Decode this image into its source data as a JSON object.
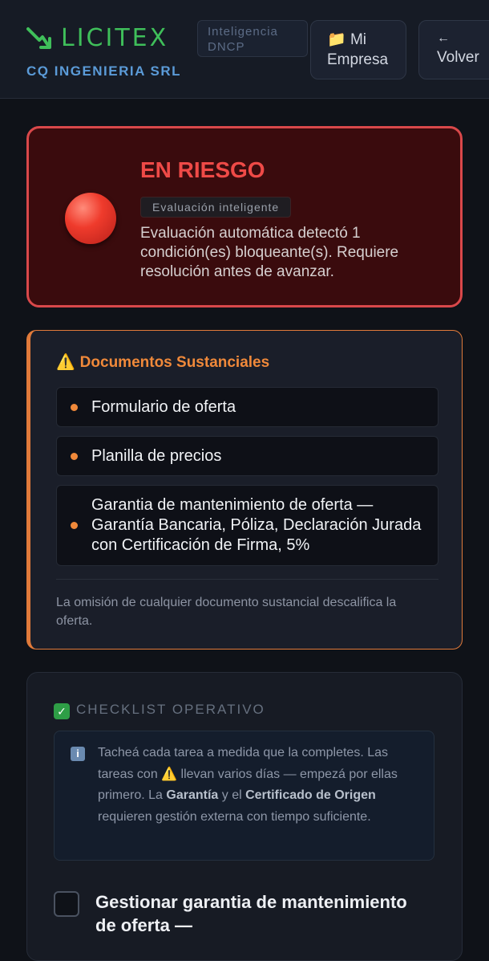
{
  "header": {
    "logo": "LICITEX",
    "company": "CQ INGENIERIA SRL",
    "badge_line1": "Inteligencia",
    "badge_line2": "DNCP",
    "empresa_icon": "📁",
    "empresa_line1": "Mi",
    "empresa_line2": "Empresa",
    "volver_arrow": "←",
    "volver_label": "Volver"
  },
  "risk": {
    "title": "EN RIESGO",
    "badge": "Evaluación inteligente",
    "text": "Evaluación automática detectó 1 condición(es) bloqueante(s). Requiere resolución antes de avanzar."
  },
  "docs": {
    "icon": "⚠️",
    "title": "Documentos Sustanciales",
    "items": [
      "Formulario de oferta",
      "Planilla de precios",
      "Garantia de mantenimiento de oferta — Garantía Bancaria, Póliza, Declaración Jurada con Certificación de Firma, 5%"
    ],
    "note": "La omisión de cualquier documento sustancial descalifica la oferta."
  },
  "checklist": {
    "check_icon": "✓",
    "title": "CHECKLIST OPERATIVO",
    "info_icon": "i",
    "info_part1": "Tacheá cada tarea a medida que la completes. Las tareas con ",
    "info_warn": "⚠️",
    "info_part2": " llevan varios días — empezá por ellas primero. La ",
    "info_bold1": "Garantía",
    "info_part3": " y el ",
    "info_bold2": "Certificado de Origen",
    "info_part4": " requieren gestión externa con tiempo suficiente.",
    "task": "Gestionar garantia de mantenimiento de oferta —"
  },
  "colors": {
    "brand_green": "#3fbf5a",
    "risk_red": "#ef4a47",
    "warn_orange": "#f0893a"
  }
}
